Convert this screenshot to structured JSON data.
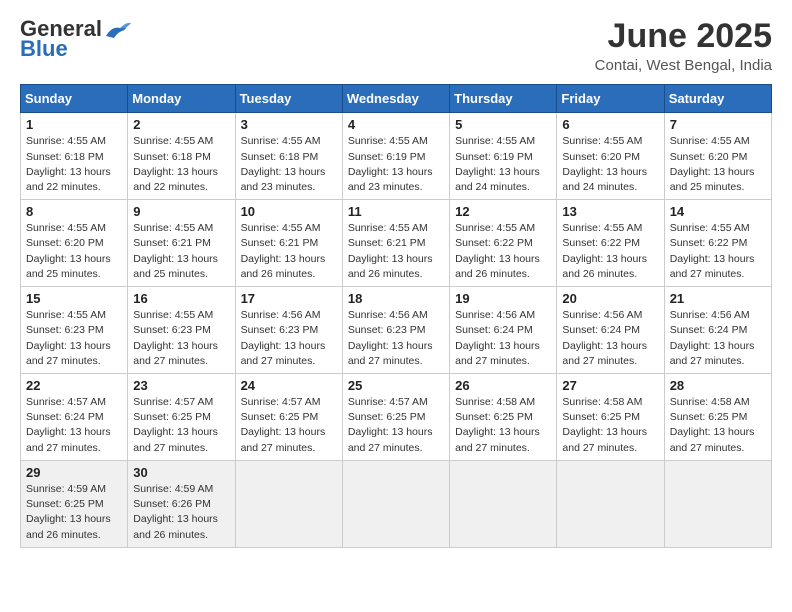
{
  "logo": {
    "general": "General",
    "blue": "Blue"
  },
  "header": {
    "month": "June 2025",
    "location": "Contai, West Bengal, India"
  },
  "weekdays": [
    "Sunday",
    "Monday",
    "Tuesday",
    "Wednesday",
    "Thursday",
    "Friday",
    "Saturday"
  ],
  "weeks": [
    [
      {
        "day": "1",
        "sunrise": "4:55 AM",
        "sunset": "6:18 PM",
        "daylight": "13 hours and 22 minutes."
      },
      {
        "day": "2",
        "sunrise": "4:55 AM",
        "sunset": "6:18 PM",
        "daylight": "13 hours and 22 minutes."
      },
      {
        "day": "3",
        "sunrise": "4:55 AM",
        "sunset": "6:18 PM",
        "daylight": "13 hours and 23 minutes."
      },
      {
        "day": "4",
        "sunrise": "4:55 AM",
        "sunset": "6:19 PM",
        "daylight": "13 hours and 23 minutes."
      },
      {
        "day": "5",
        "sunrise": "4:55 AM",
        "sunset": "6:19 PM",
        "daylight": "13 hours and 24 minutes."
      },
      {
        "day": "6",
        "sunrise": "4:55 AM",
        "sunset": "6:20 PM",
        "daylight": "13 hours and 24 minutes."
      },
      {
        "day": "7",
        "sunrise": "4:55 AM",
        "sunset": "6:20 PM",
        "daylight": "13 hours and 25 minutes."
      }
    ],
    [
      {
        "day": "8",
        "sunrise": "4:55 AM",
        "sunset": "6:20 PM",
        "daylight": "13 hours and 25 minutes."
      },
      {
        "day": "9",
        "sunrise": "4:55 AM",
        "sunset": "6:21 PM",
        "daylight": "13 hours and 25 minutes."
      },
      {
        "day": "10",
        "sunrise": "4:55 AM",
        "sunset": "6:21 PM",
        "daylight": "13 hours and 26 minutes."
      },
      {
        "day": "11",
        "sunrise": "4:55 AM",
        "sunset": "6:21 PM",
        "daylight": "13 hours and 26 minutes."
      },
      {
        "day": "12",
        "sunrise": "4:55 AM",
        "sunset": "6:22 PM",
        "daylight": "13 hours and 26 minutes."
      },
      {
        "day": "13",
        "sunrise": "4:55 AM",
        "sunset": "6:22 PM",
        "daylight": "13 hours and 26 minutes."
      },
      {
        "day": "14",
        "sunrise": "4:55 AM",
        "sunset": "6:22 PM",
        "daylight": "13 hours and 27 minutes."
      }
    ],
    [
      {
        "day": "15",
        "sunrise": "4:55 AM",
        "sunset": "6:23 PM",
        "daylight": "13 hours and 27 minutes."
      },
      {
        "day": "16",
        "sunrise": "4:55 AM",
        "sunset": "6:23 PM",
        "daylight": "13 hours and 27 minutes."
      },
      {
        "day": "17",
        "sunrise": "4:56 AM",
        "sunset": "6:23 PM",
        "daylight": "13 hours and 27 minutes."
      },
      {
        "day": "18",
        "sunrise": "4:56 AM",
        "sunset": "6:23 PM",
        "daylight": "13 hours and 27 minutes."
      },
      {
        "day": "19",
        "sunrise": "4:56 AM",
        "sunset": "6:24 PM",
        "daylight": "13 hours and 27 minutes."
      },
      {
        "day": "20",
        "sunrise": "4:56 AM",
        "sunset": "6:24 PM",
        "daylight": "13 hours and 27 minutes."
      },
      {
        "day": "21",
        "sunrise": "4:56 AM",
        "sunset": "6:24 PM",
        "daylight": "13 hours and 27 minutes."
      }
    ],
    [
      {
        "day": "22",
        "sunrise": "4:57 AM",
        "sunset": "6:24 PM",
        "daylight": "13 hours and 27 minutes."
      },
      {
        "day": "23",
        "sunrise": "4:57 AM",
        "sunset": "6:25 PM",
        "daylight": "13 hours and 27 minutes."
      },
      {
        "day": "24",
        "sunrise": "4:57 AM",
        "sunset": "6:25 PM",
        "daylight": "13 hours and 27 minutes."
      },
      {
        "day": "25",
        "sunrise": "4:57 AM",
        "sunset": "6:25 PM",
        "daylight": "13 hours and 27 minutes."
      },
      {
        "day": "26",
        "sunrise": "4:58 AM",
        "sunset": "6:25 PM",
        "daylight": "13 hours and 27 minutes."
      },
      {
        "day": "27",
        "sunrise": "4:58 AM",
        "sunset": "6:25 PM",
        "daylight": "13 hours and 27 minutes."
      },
      {
        "day": "28",
        "sunrise": "4:58 AM",
        "sunset": "6:25 PM",
        "daylight": "13 hours and 27 minutes."
      }
    ],
    [
      {
        "day": "29",
        "sunrise": "4:59 AM",
        "sunset": "6:25 PM",
        "daylight": "13 hours and 26 minutes."
      },
      {
        "day": "30",
        "sunrise": "4:59 AM",
        "sunset": "6:26 PM",
        "daylight": "13 hours and 26 minutes."
      },
      null,
      null,
      null,
      null,
      null
    ]
  ],
  "labels": {
    "sunrise": "Sunrise:",
    "sunset": "Sunset:",
    "daylight": "Daylight:"
  }
}
